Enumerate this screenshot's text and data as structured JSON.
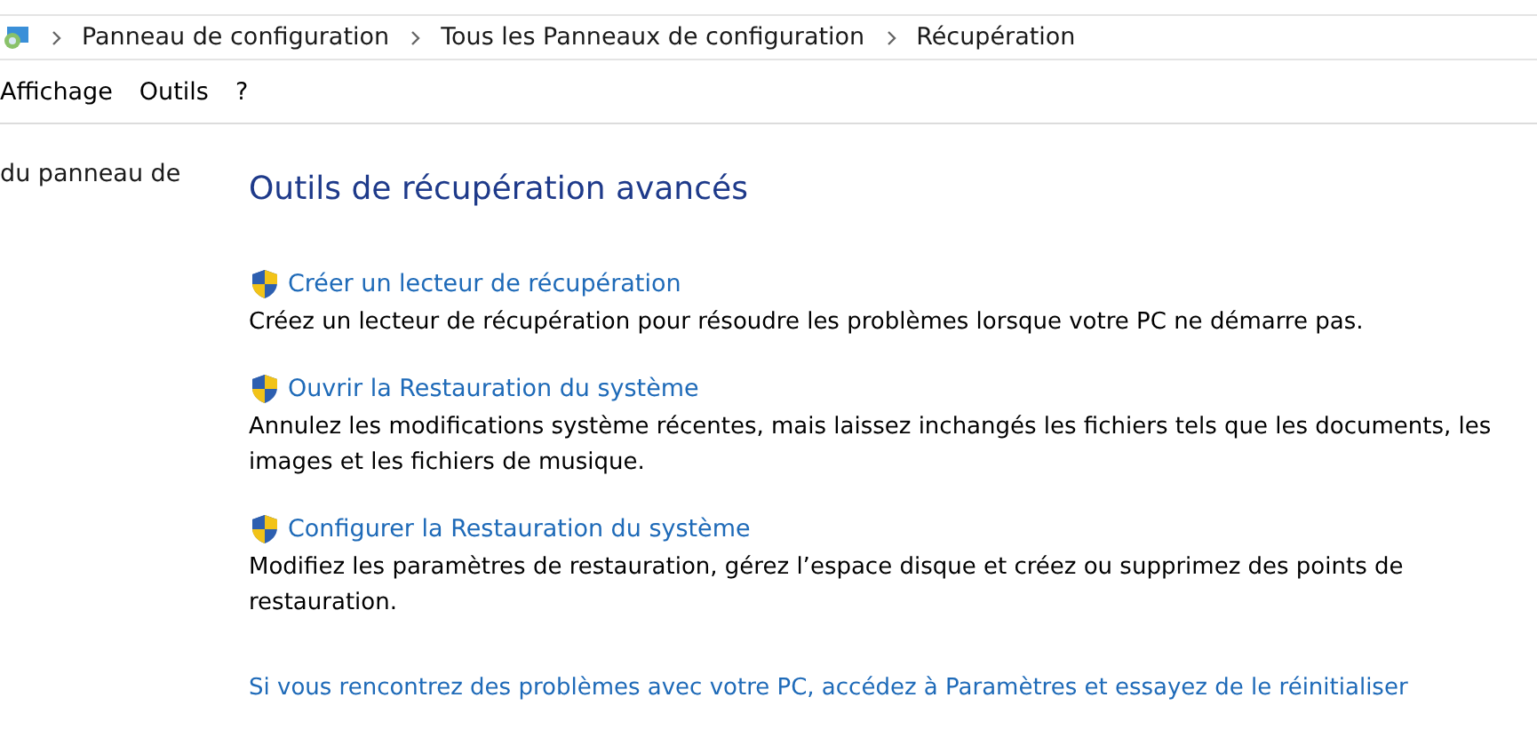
{
  "breadcrumb": [
    "Panneau de configuration",
    "Tous les Panneaux de configuration",
    "Récupération"
  ],
  "menu": [
    "Affichage",
    "Outils",
    "?"
  ],
  "sidebar": {
    "text": "du panneau de"
  },
  "heading": "Outils de récupération avancés",
  "tools": [
    {
      "link": "Créer un lecteur de récupération",
      "description": "Créez un lecteur de récupération pour résoudre les problèmes lorsque votre PC ne démarre pas."
    },
    {
      "link": "Ouvrir la Restauration du système",
      "description": "Annulez les modifications système récentes, mais laissez inchangés les fichiers tels que les documents, les images et les fichiers de musique."
    },
    {
      "link": "Configurer la Restauration du système",
      "description": "Modifiez les paramètres de restauration, gérez l’espace disque et créez ou supprimez des points de restauration."
    }
  ],
  "footer_link": "Si vous rencontrez des problèmes avec votre PC, accédez à Paramètres et essayez de le réinitialiser"
}
